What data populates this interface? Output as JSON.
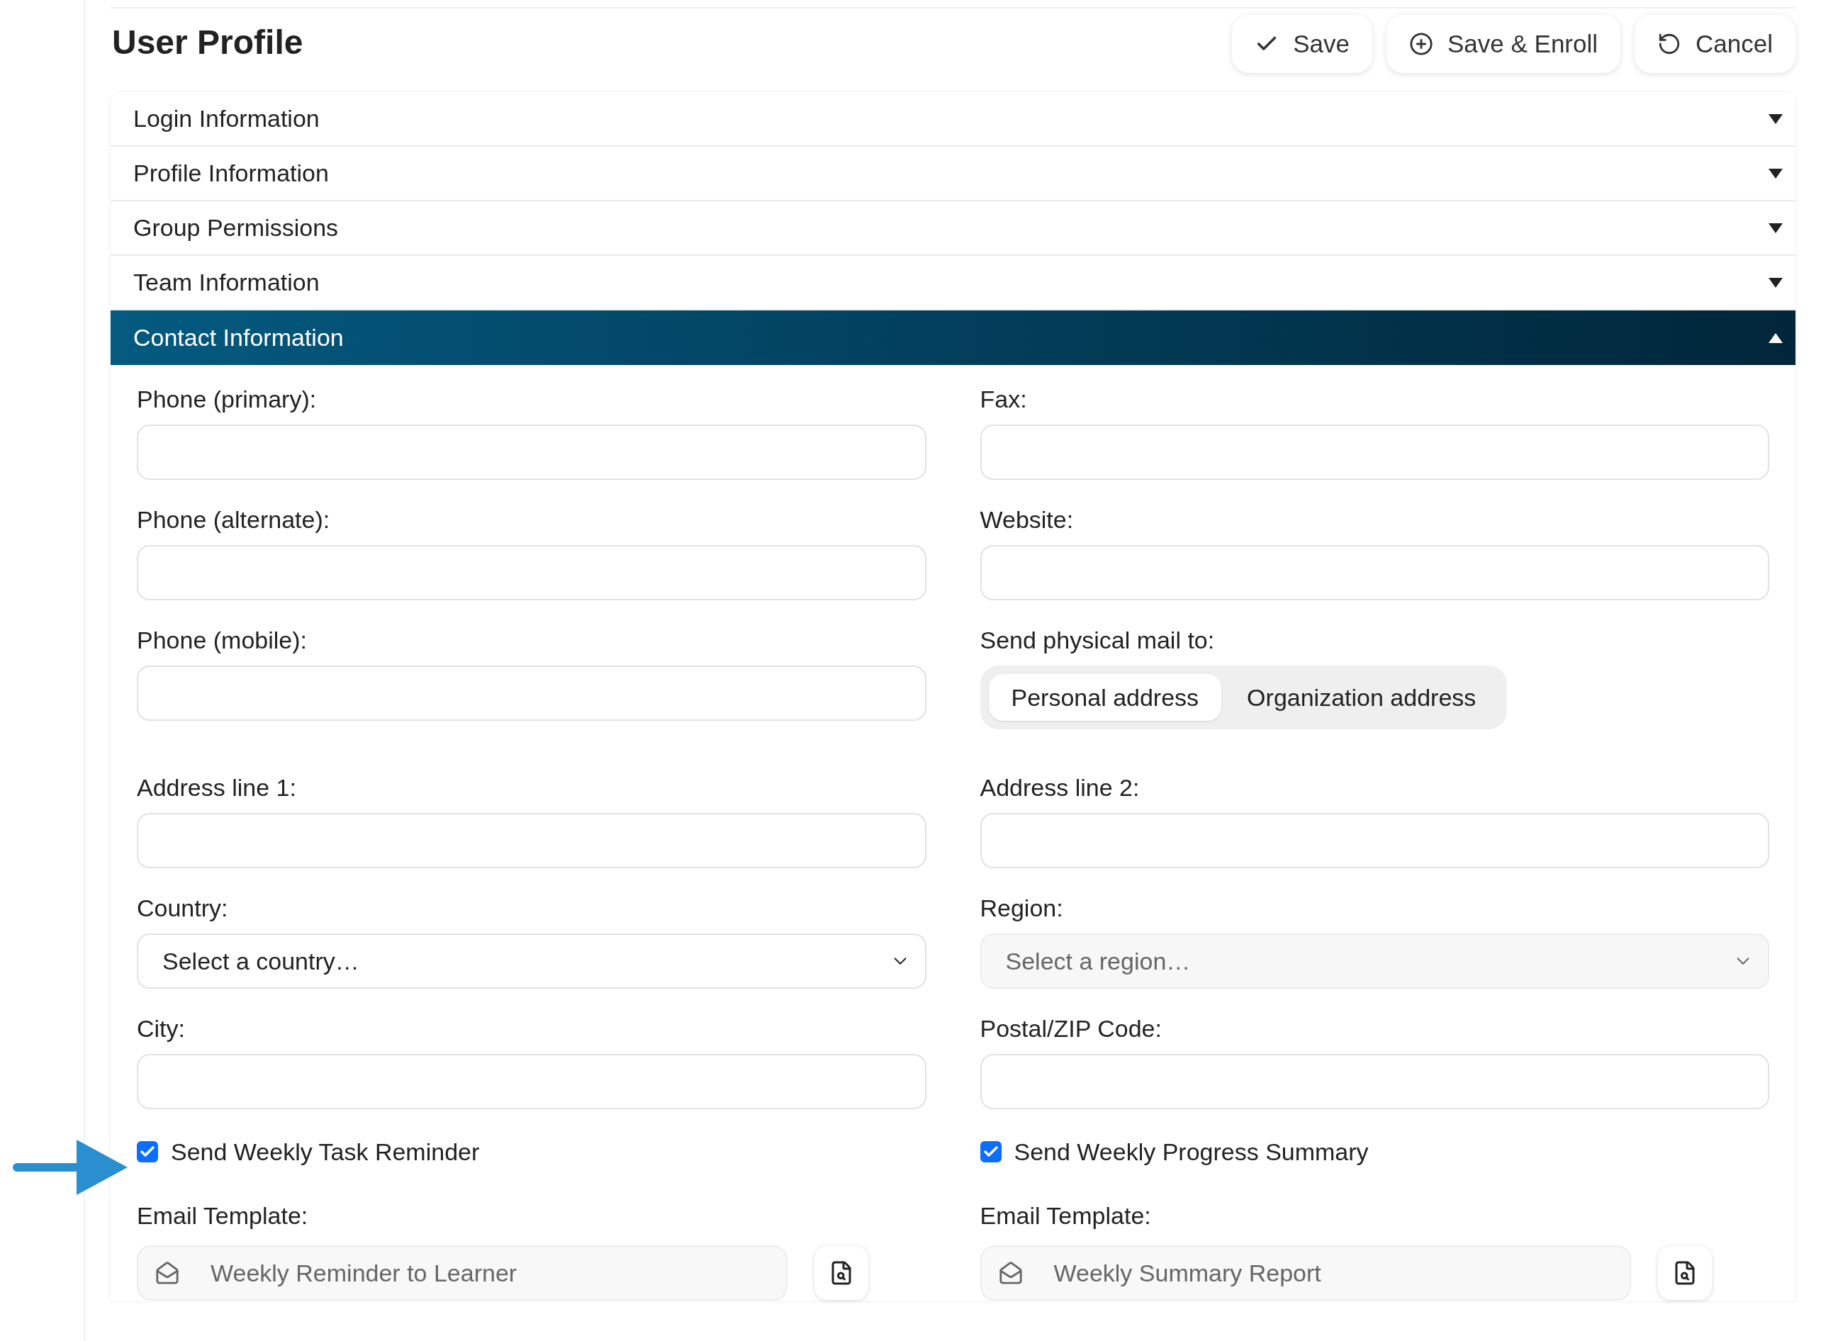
{
  "page": {
    "title": "User Profile"
  },
  "actions": [
    {
      "kind": "check",
      "label": "Save"
    },
    {
      "kind": "plus",
      "label": "Save & Enroll"
    },
    {
      "kind": "undo",
      "label": "Cancel"
    }
  ],
  "sections": [
    {
      "title": "Login Information",
      "expanded": false
    },
    {
      "title": "Profile Information",
      "expanded": false
    },
    {
      "title": "Group Permissions",
      "expanded": false
    },
    {
      "title": "Team Information",
      "expanded": false
    },
    {
      "title": "Contact Information",
      "expanded": true
    }
  ],
  "fields": [
    {
      "kind": "text",
      "label": "Phone (primary):"
    },
    {
      "kind": "text",
      "label": "Fax:"
    },
    {
      "kind": "text",
      "label": "Phone (alternate):"
    },
    {
      "kind": "text",
      "label": "Website:"
    },
    {
      "kind": "text",
      "label": "Phone (mobile):"
    },
    {
      "kind": "segmented",
      "label": "Send physical mail to:",
      "options": [
        {
          "label": "Personal address",
          "selected": true
        },
        {
          "label": "Organization address",
          "selected": false
        }
      ]
    },
    {
      "kind": "text",
      "label": "Address line 1:"
    },
    {
      "kind": "text",
      "label": "Address line 2:"
    },
    {
      "kind": "select",
      "label": "Country:",
      "placeholder": "Select a country…",
      "disabled": false
    },
    {
      "kind": "select",
      "label": "Region:",
      "placeholder": "Select a region…",
      "disabled": true
    },
    {
      "kind": "text",
      "label": "City:"
    },
    {
      "kind": "text",
      "label": "Postal/ZIP Code:"
    }
  ],
  "notifications": [
    {
      "label": "Send Weekly Task Reminder",
      "checked": true,
      "template_label": "Email Template:",
      "template": "Weekly Reminder to Learner"
    },
    {
      "label": "Send Weekly Progress Summary",
      "checked": true,
      "template_label": "Email Template:",
      "template": "Weekly Summary Report"
    }
  ]
}
